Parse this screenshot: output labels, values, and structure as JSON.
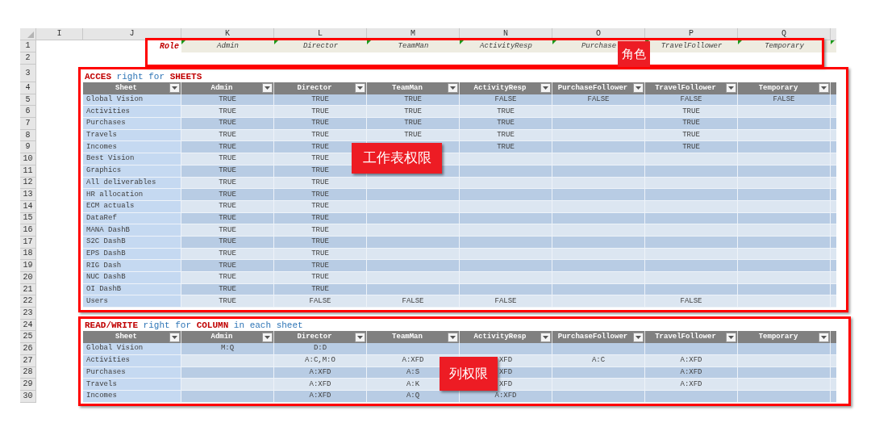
{
  "column_letters": [
    "I",
    "J",
    "K",
    "L",
    "M",
    "N",
    "O",
    "P",
    "Q"
  ],
  "row_numbers": [
    "1",
    "2",
    "3",
    "4",
    "5",
    "6",
    "7",
    "8",
    "9",
    "10",
    "11",
    "12",
    "13",
    "14",
    "15",
    "16",
    "17",
    "18",
    "19",
    "20",
    "21",
    "22",
    "23",
    "24",
    "25",
    "26",
    "27",
    "28",
    "29",
    "30"
  ],
  "roles": {
    "label": "Role",
    "items": [
      "Admin",
      "Director",
      "TeamMan",
      "ActivityResp",
      "Purchase",
      "TravelFollower",
      "Temporary"
    ]
  },
  "sheet_access": {
    "title": "**ACCES** right for **SHEETS**",
    "columns": [
      "Sheet",
      "Admin",
      "Director",
      "TeamMan",
      "ActivityResp",
      "PurchaseFollower",
      "TravelFollower",
      "Temporary"
    ],
    "rows": [
      {
        "cells": [
          "Global Vision",
          "TRUE",
          "TRUE",
          "TRUE",
          "FALSE",
          "FALSE",
          "FALSE",
          "FALSE"
        ]
      },
      {
        "cells": [
          "Activities",
          "TRUE",
          "TRUE",
          "TRUE",
          "TRUE",
          "",
          "TRUE",
          ""
        ]
      },
      {
        "cells": [
          "Purchases",
          "TRUE",
          "TRUE",
          "TRUE",
          "TRUE",
          "",
          "TRUE",
          ""
        ]
      },
      {
        "cells": [
          "Travels",
          "TRUE",
          "TRUE",
          "TRUE",
          "TRUE",
          "",
          "TRUE",
          ""
        ]
      },
      {
        "cells": [
          "Incomes",
          "TRUE",
          "TRUE",
          "",
          "TRUE",
          "",
          "TRUE",
          ""
        ]
      },
      {
        "cells": [
          "Best Vision",
          "TRUE",
          "TRUE",
          "",
          "",
          "",
          "",
          ""
        ]
      },
      {
        "cells": [
          "Graphics",
          "TRUE",
          "TRUE",
          "",
          "",
          "",
          "",
          ""
        ]
      },
      {
        "cells": [
          "All deliverables",
          "TRUE",
          "TRUE",
          "",
          "",
          "",
          "",
          ""
        ]
      },
      {
        "cells": [
          "HR allocation",
          "TRUE",
          "TRUE",
          "",
          "",
          "",
          "",
          ""
        ]
      },
      {
        "cells": [
          "ECM actuals",
          "TRUE",
          "TRUE",
          "",
          "",
          "",
          "",
          ""
        ]
      },
      {
        "cells": [
          "DataRef",
          "TRUE",
          "TRUE",
          "",
          "",
          "",
          "",
          ""
        ]
      },
      {
        "cells": [
          "MANA DashB",
          "TRUE",
          "TRUE",
          "",
          "",
          "",
          "",
          ""
        ]
      },
      {
        "cells": [
          "S2C DashB",
          "TRUE",
          "TRUE",
          "",
          "",
          "",
          "",
          ""
        ]
      },
      {
        "cells": [
          "EPS DashB",
          "TRUE",
          "TRUE",
          "",
          "",
          "",
          "",
          ""
        ]
      },
      {
        "cells": [
          "RIG Dash",
          "TRUE",
          "TRUE",
          "",
          "",
          "",
          "",
          ""
        ]
      },
      {
        "cells": [
          "NUC DashB",
          "TRUE",
          "TRUE",
          "",
          "",
          "",
          "",
          ""
        ]
      },
      {
        "cells": [
          "OI DashB",
          "TRUE",
          "TRUE",
          "",
          "",
          "",
          "",
          ""
        ]
      },
      {
        "cells": [
          "Users",
          "TRUE",
          "FALSE",
          "FALSE",
          "FALSE",
          "",
          "FALSE",
          ""
        ]
      }
    ]
  },
  "column_access": {
    "title": "**READ/WRITE** right for **COLUMN** in each sheet",
    "columns": [
      "Sheet",
      "Admin",
      "Director",
      "TeamMan",
      "ActivityResp",
      "PurchaseFollower",
      "TravelFollower",
      "Temporary"
    ],
    "rows": [
      {
        "cells": [
          "Global Vision",
          "M:Q",
          "D:D",
          "",
          "",
          "",
          "",
          ""
        ]
      },
      {
        "cells": [
          "Activities",
          "",
          "A:C,M:O",
          "A:XFD",
          "XFD",
          "A:C",
          "A:XFD",
          ""
        ]
      },
      {
        "cells": [
          "Purchases",
          "",
          "A:XFD",
          "A:S",
          "XFD",
          "",
          "A:XFD",
          ""
        ]
      },
      {
        "cells": [
          "Travels",
          "",
          "A:XFD",
          "A:K",
          "XFD",
          "",
          "A:XFD",
          ""
        ]
      },
      {
        "cells": [
          "Incomes",
          "",
          "A:XFD",
          "A:Q",
          "A:XFD",
          "",
          "",
          ""
        ]
      }
    ]
  },
  "annotations": [
    {
      "label": "角色"
    },
    {
      "label": "工作表权限"
    },
    {
      "label": "列权限"
    }
  ]
}
